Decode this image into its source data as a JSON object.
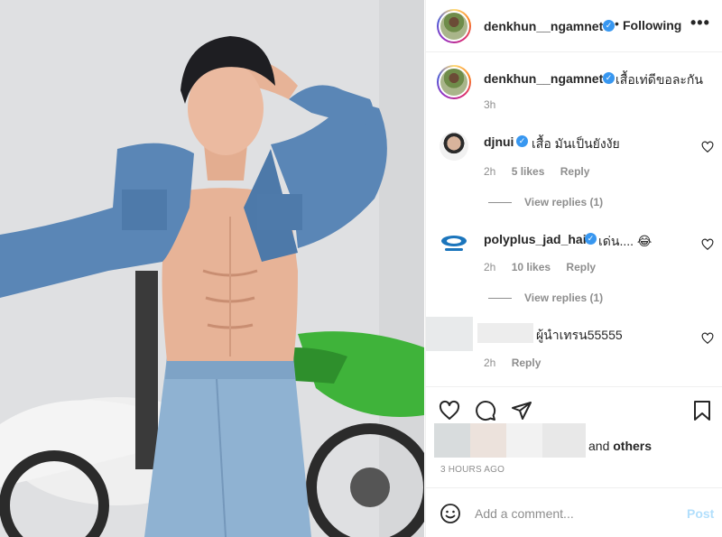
{
  "post": {
    "author": "denkhun__ngamnet",
    "verified_icon": "verified-badge-icon",
    "follow_status": "Following",
    "more_icon": "more-horizontal-icon",
    "caption": "เสื้อเท่ดีขอละกัน",
    "caption_time": "3h"
  },
  "comments": [
    {
      "username": "djnui",
      "verified": true,
      "text": "เสื้อ มันเป็นยังงัย",
      "time": "2h",
      "likes": "5 likes",
      "reply_label": "Reply",
      "view_replies": "View replies (1)"
    },
    {
      "username": "polyplus_jad_hai",
      "verified": true,
      "text": "เด่น.... 😂",
      "time": "2h",
      "likes": "10 likes",
      "reply_label": "Reply",
      "view_replies": "View replies (1)"
    },
    {
      "username_hidden": true,
      "text": "ผู้นำเทรน55555",
      "time": "2h",
      "reply_label": "Reply"
    }
  ],
  "actions": {
    "like_icon": "heart-icon",
    "comment_icon": "comment-icon",
    "share_icon": "send-icon",
    "save_icon": "bookmark-icon"
  },
  "likes": {
    "and_prefix": "and",
    "others": "others"
  },
  "timestamp": "3 HOURS AGO",
  "add_comment": {
    "placeholder": "Add a comment...",
    "post_label": "Post",
    "emoji_icon": "smiley-icon"
  },
  "colors": {
    "accent_blue": "#3897f0",
    "post_disabled": "#b2dffc",
    "muted_text": "#8e8e8e",
    "primary_text": "#262626"
  }
}
